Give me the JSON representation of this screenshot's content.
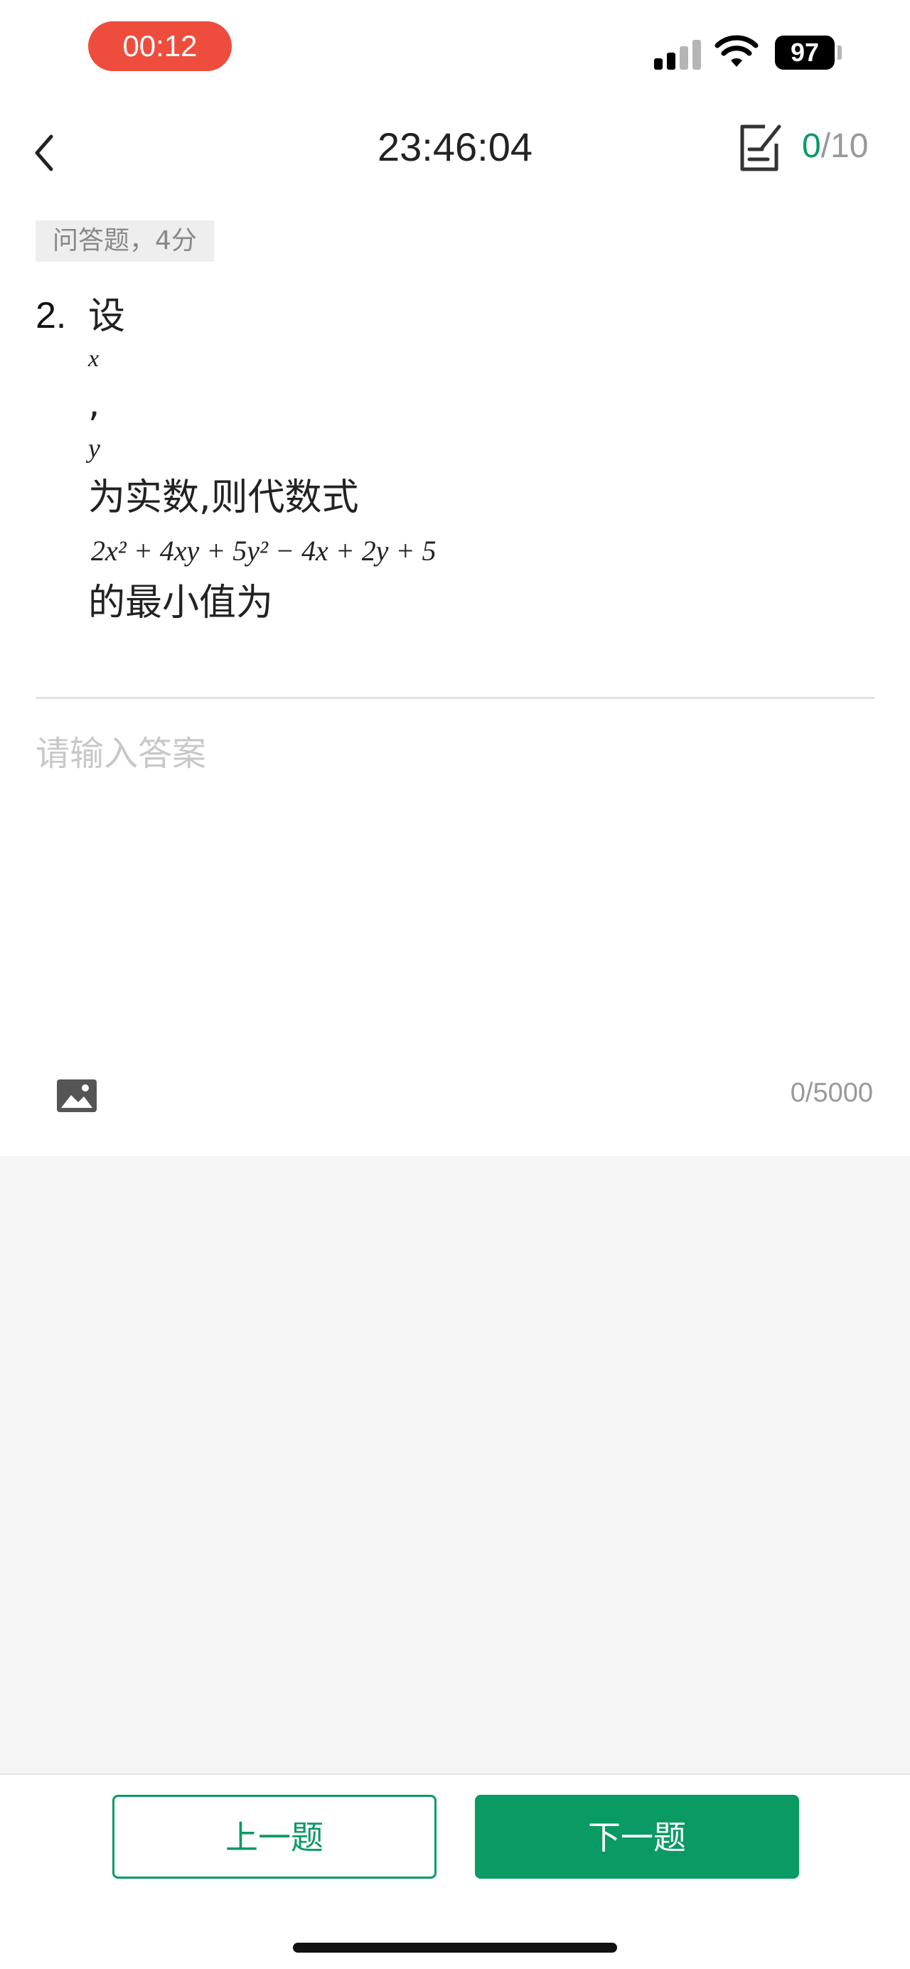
{
  "status_bar": {
    "recording_time": "00:12",
    "battery_level": "97"
  },
  "header": {
    "timer": "23:46:04",
    "answered": "0",
    "total": "/10"
  },
  "question": {
    "type_tag": "问答题，4分",
    "number": "2.",
    "lines": {
      "l1": "设",
      "l2": "x",
      "l3": ",",
      "l4": "y",
      "l5": "为实数,则代数式",
      "l6": "2x² + 4xy + 5y² − 4x + 2y + 5",
      "l7": "的最小值为"
    }
  },
  "answer": {
    "placeholder": "请输入答案",
    "char_count": "0/5000"
  },
  "nav": {
    "prev_label": "上一题",
    "next_label": "下一题"
  },
  "colors": {
    "accent": "#0a9a64",
    "recording": "#ee4d3e"
  }
}
